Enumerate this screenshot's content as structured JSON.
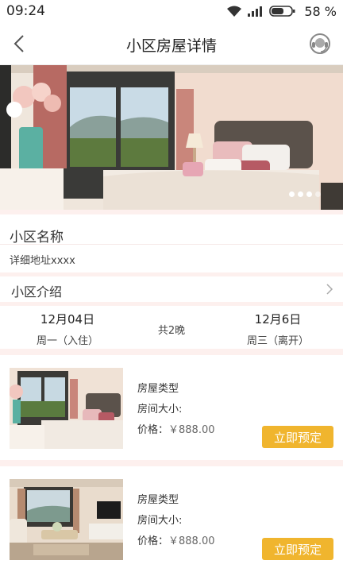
{
  "status": {
    "time": "09:24",
    "battery": "58 %"
  },
  "header": {
    "title": "小区房屋详情"
  },
  "community": {
    "name": "小区名称",
    "address": "详细地址xxxx",
    "intro_label": "小区介绍"
  },
  "stay": {
    "checkin_date": "12月04日",
    "checkin_day": "周一（入住）",
    "nights": "共2晚",
    "checkout_date": "12月6日",
    "checkout_day": "周三（离开）"
  },
  "rooms": [
    {
      "type": "房屋类型",
      "size_label": "房间大小:",
      "price_label": "价格：",
      "price": "￥888.00",
      "book_label": "立即预定"
    },
    {
      "type": "房屋类型",
      "size_label": "房间大小:",
      "price_label": "价格：",
      "price": "￥888.00",
      "book_label": "立即预定"
    }
  ],
  "carousel": {
    "total": 4,
    "active": 0
  },
  "colors": {
    "accent": "#f0b52e",
    "separator": "#fdf0ee"
  },
  "icons": {
    "back": "chevron-left-icon",
    "service": "headset-icon",
    "intro": "chevron-right-icon"
  }
}
